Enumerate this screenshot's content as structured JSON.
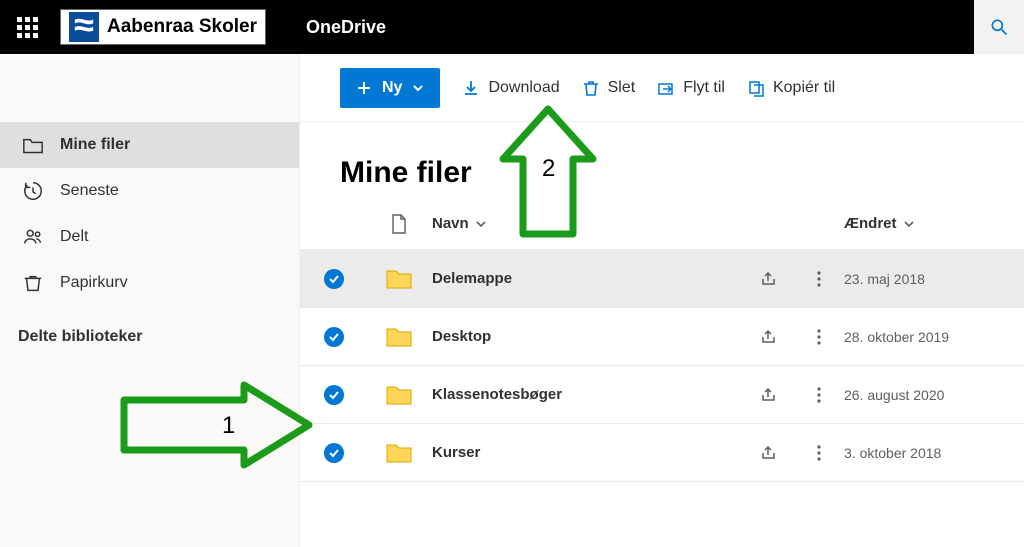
{
  "header": {
    "tenant_name": "Aabenraa Skoler",
    "app_name": "OneDrive"
  },
  "sidebar": {
    "items": [
      {
        "label": "Mine filer",
        "icon": "folder-outline-icon",
        "active": true
      },
      {
        "label": "Seneste",
        "icon": "history-icon",
        "active": false
      },
      {
        "label": "Delt",
        "icon": "people-icon",
        "active": false
      },
      {
        "label": "Papirkurv",
        "icon": "trash-icon",
        "active": false
      }
    ],
    "section_header": "Delte biblioteker"
  },
  "commandbar": {
    "new_label": "Ny",
    "download": "Download",
    "delete": "Slet",
    "move_to": "Flyt til",
    "copy_to": "Kopiér til"
  },
  "page": {
    "title": "Mine filer"
  },
  "table": {
    "columns": {
      "name": "Navn",
      "modified": "Ændret"
    },
    "rows": [
      {
        "name": "Delemappe",
        "modified": "23. maj 2018",
        "selected": true
      },
      {
        "name": "Desktop",
        "modified": "28. oktober 2019",
        "selected": true
      },
      {
        "name": "Klassenotesbøger",
        "modified": "26. august 2020",
        "selected": true
      },
      {
        "name": "Kurser",
        "modified": "3. oktober 2018",
        "selected": true
      }
    ]
  },
  "annotations": {
    "step1": "1",
    "step2": "2"
  }
}
